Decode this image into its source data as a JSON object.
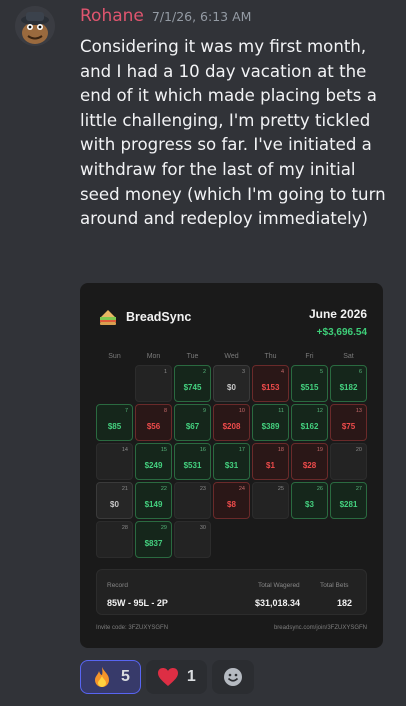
{
  "message": {
    "author": "Rohane",
    "timestamp": "7/1/26, 6:13 AM",
    "text": "Considering it was my first month, and I had a 10 day vacation at the end of it which made placing bets a little challenging, I'm pretty tickled with progress so far. I've initiated a withdraw for the last of my initial seed money (which I'm going to turn around and redeploy immediately)"
  },
  "card": {
    "brand": "BreadSync",
    "month": "June 2026",
    "total": "+$3,696.54",
    "weekdays": [
      "Sun",
      "Mon",
      "Tue",
      "Wed",
      "Thu",
      "Fri",
      "Sat"
    ],
    "days": [
      {
        "day": "",
        "amount": "",
        "status": "empty"
      },
      {
        "day": "1",
        "amount": "",
        "status": "none"
      },
      {
        "day": "2",
        "amount": "$745",
        "status": "win"
      },
      {
        "day": "3",
        "amount": "$0",
        "status": "push"
      },
      {
        "day": "4",
        "amount": "$153",
        "status": "loss"
      },
      {
        "day": "5",
        "amount": "$515",
        "status": "win"
      },
      {
        "day": "6",
        "amount": "$182",
        "status": "win"
      },
      {
        "day": "7",
        "amount": "$85",
        "status": "win"
      },
      {
        "day": "8",
        "amount": "$56",
        "status": "loss"
      },
      {
        "day": "9",
        "amount": "$67",
        "status": "win"
      },
      {
        "day": "10",
        "amount": "$208",
        "status": "loss"
      },
      {
        "day": "11",
        "amount": "$389",
        "status": "win"
      },
      {
        "day": "12",
        "amount": "$162",
        "status": "win"
      },
      {
        "day": "13",
        "amount": "$75",
        "status": "loss"
      },
      {
        "day": "14",
        "amount": "",
        "status": "none"
      },
      {
        "day": "15",
        "amount": "$249",
        "status": "win"
      },
      {
        "day": "16",
        "amount": "$531",
        "status": "win"
      },
      {
        "day": "17",
        "amount": "$31",
        "status": "win"
      },
      {
        "day": "18",
        "amount": "$1",
        "status": "loss"
      },
      {
        "day": "19",
        "amount": "$28",
        "status": "loss"
      },
      {
        "day": "20",
        "amount": "",
        "status": "none"
      },
      {
        "day": "21",
        "amount": "$0",
        "status": "push"
      },
      {
        "day": "22",
        "amount": "$149",
        "status": "win"
      },
      {
        "day": "23",
        "amount": "",
        "status": "none"
      },
      {
        "day": "24",
        "amount": "$8",
        "status": "loss"
      },
      {
        "day": "25",
        "amount": "",
        "status": "none"
      },
      {
        "day": "26",
        "amount": "$3",
        "status": "win"
      },
      {
        "day": "27",
        "amount": "$281",
        "status": "win"
      },
      {
        "day": "28",
        "amount": "",
        "status": "none"
      },
      {
        "day": "29",
        "amount": "$837",
        "status": "win"
      },
      {
        "day": "30",
        "amount": "",
        "status": "none"
      }
    ],
    "stats": {
      "record_label": "Record",
      "record_value": "85W - 95L - 2P",
      "wagered_label": "Total Wagered",
      "wagered_value": "$31,018.34",
      "bets_label": "Total Bets",
      "bets_value": "182"
    },
    "invite": "Invite code: 3FZUXYSGFN",
    "link": "breadsync.com/join/3FZUXYSGFN"
  },
  "reactions": [
    {
      "icon": "fire-icon",
      "count": "5",
      "me": true
    },
    {
      "icon": "heart-icon",
      "count": "1",
      "me": false
    }
  ],
  "colors": {
    "author": "#e0556f",
    "win": "#44d17f",
    "loss": "#ee4b4b",
    "background": "#313338"
  }
}
